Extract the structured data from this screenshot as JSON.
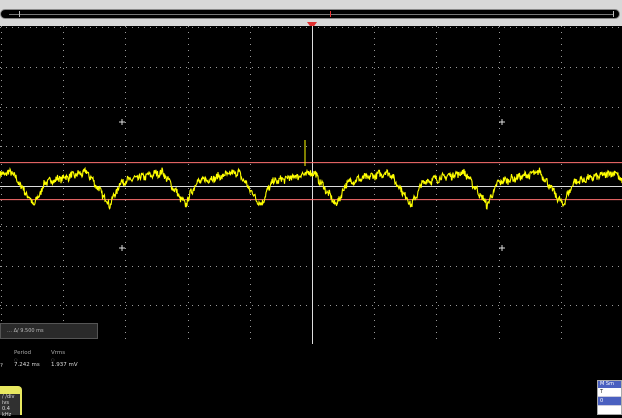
{
  "cursor_readout": {
    "text": "… Δ/ 9.500 ms"
  },
  "measurements": {
    "left_partial": "?",
    "items": [
      {
        "label": "Period",
        "dot": "○",
        "value": "7.242 ms"
      },
      {
        "label": "Vrms",
        "dot": "○",
        "value": "1.937 mV"
      }
    ]
  },
  "channel_badge": {
    "line1": "/ /div",
    "line2": "ivs",
    "line3": "0.4 kHz"
  },
  "mini_panel": {
    "header": "M    Sm",
    "rows": [
      {
        "a": "T",
        "b": "0"
      },
      {
        "a": "0",
        "b": "0"
      }
    ]
  },
  "colors": {
    "trace": "#ffff00",
    "grid": "#aaaaaa",
    "cursor": "#ff7070",
    "trigger": "#e03030"
  },
  "chart_data": {
    "type": "line",
    "series": [
      {
        "name": "",
        "color": "#ffff00"
      }
    ],
    "grid": true,
    "divisions": {
      "x": 10,
      "y": 8
    },
    "cursor_levels_div": [
      0.6,
      -0.33
    ],
    "trace_center_div": 0.25
  }
}
